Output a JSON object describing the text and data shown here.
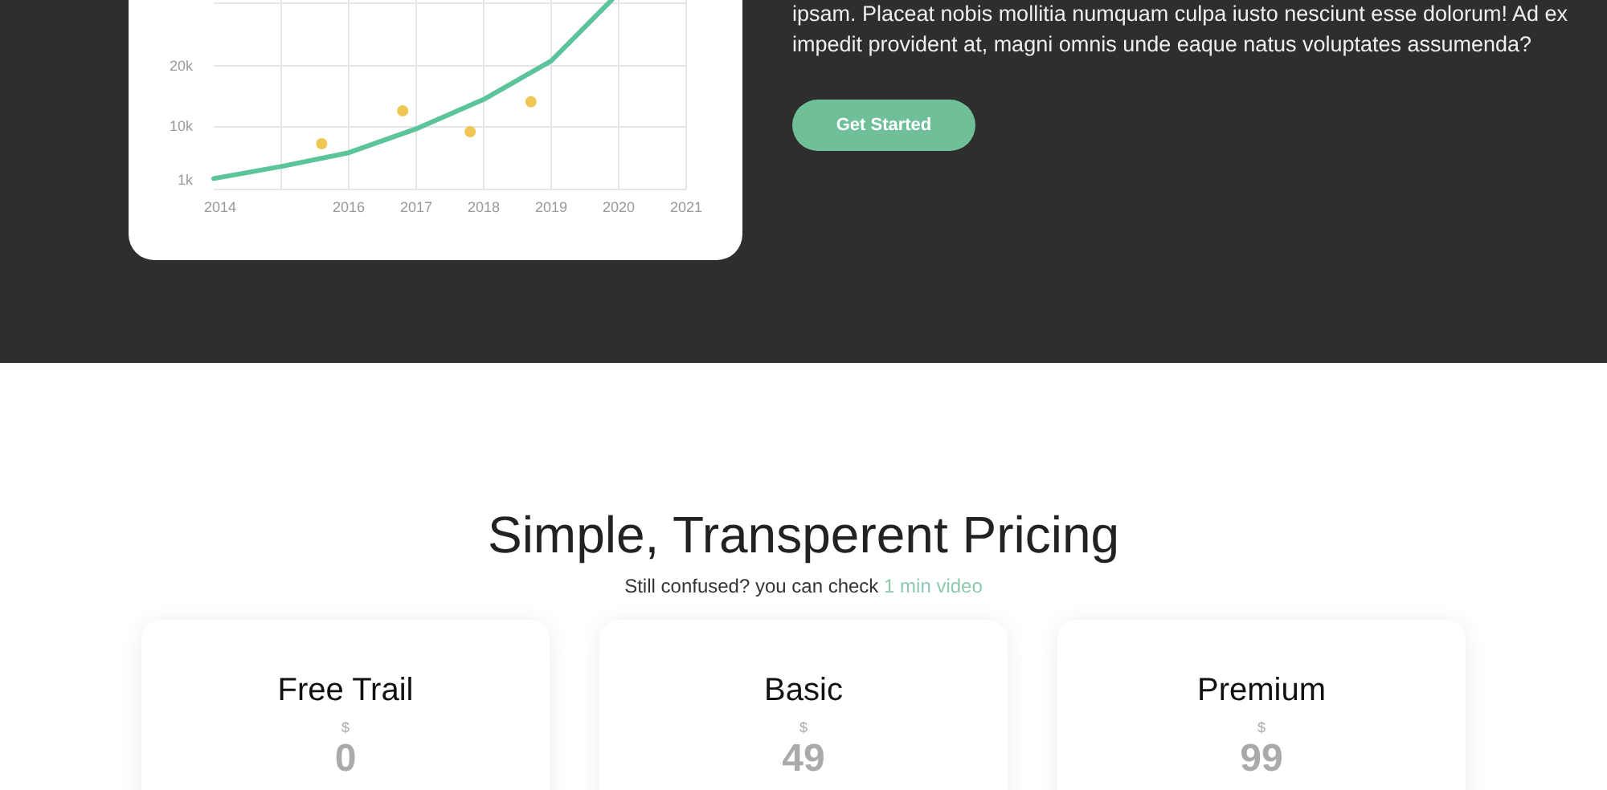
{
  "hero": {
    "chart_data": {
      "type": "line",
      "x": [
        2014,
        2015,
        2015.6,
        2016,
        2016.8,
        2017,
        2017.8,
        2018,
        2018.7,
        2019,
        2019.9
      ],
      "xticks": [
        2014,
        2016,
        2017,
        2018,
        2019,
        2020,
        2021
      ],
      "yticks": [
        {
          "value": 1,
          "label": "1k"
        },
        {
          "value": 10,
          "label": "10k"
        },
        {
          "value": 20,
          "label": "20k"
        }
      ],
      "grid": true,
      "xlim": [
        2014,
        2021
      ],
      "ylim": [
        0,
        31
      ],
      "series": [
        {
          "type": "line",
          "color": "#5cc49a",
          "values": [
            1.2,
            3.2,
            null,
            5.5,
            null,
            9.5,
            null,
            14.4,
            null,
            20.8,
            31
          ]
        },
        {
          "type": "scatter",
          "color": "#efc653",
          "values": [
            null,
            null,
            7,
            null,
            12.5,
            null,
            9,
            null,
            14,
            null,
            null
          ]
        }
      ]
    },
    "text": "ipsam. Placeat nobis mollitia numquam culpa iusto nesciunt esse dolorum! Ad ex impedit provident at, magni omnis unde eaque natus voluptates assumenda?",
    "button": "Get Started"
  },
  "pricing": {
    "title": "Simple, Transperent Pricing",
    "subtitle": "Still confused? you can check",
    "link": "1 min video",
    "plans": [
      {
        "name": "Free Trail",
        "currency": "$",
        "price": "0"
      },
      {
        "name": "Basic",
        "currency": "$",
        "price": "49"
      },
      {
        "name": "Premium",
        "currency": "$",
        "price": "99"
      }
    ]
  }
}
